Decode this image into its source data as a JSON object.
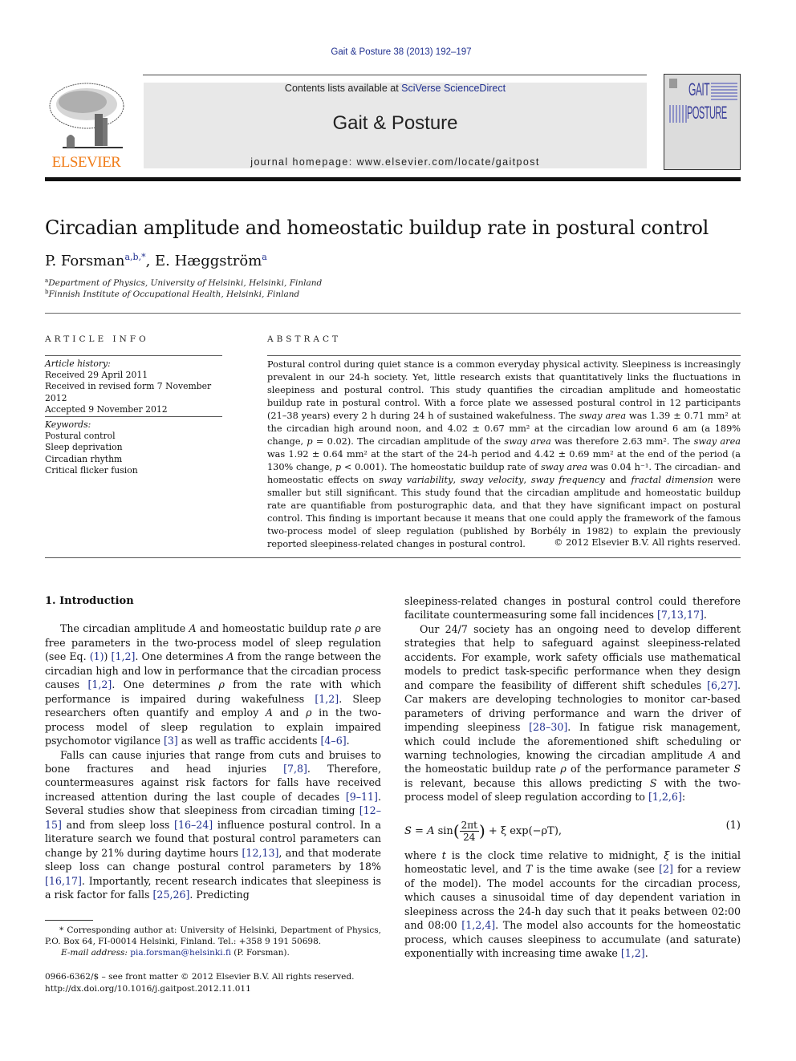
{
  "header": {
    "journal_ref": "Gait & Posture 38 (2013) 192–197",
    "contents_prefix": "Contents lists available at ",
    "contents_link": "SciVerse ScienceDirect",
    "journal_name": "Gait & Posture",
    "homepage_prefix": "journal homepage: ",
    "homepage_url": "www.elsevier.com/locate/gaitpost",
    "publisher_logo_text": "ELSEVIER",
    "cover_title_top": "GAIT",
    "cover_title_bottom": "POSTURE",
    "colors": {
      "link": "#1f2f8f",
      "publisher_orange": "#f07d1a",
      "banner_bg": "#e8e8e8",
      "cover_blue": "#3a3f9a"
    }
  },
  "article": {
    "title": "Circadian amplitude and homeostatic buildup rate in postural control",
    "authors": [
      {
        "name": "P. Forsman",
        "sup": "a,b,*"
      },
      {
        "name": "E. Hæggström",
        "sup": "a"
      }
    ],
    "affiliations": [
      {
        "mark": "a",
        "text": "Department of Physics, University of Helsinki, Helsinki, Finland"
      },
      {
        "mark": "b",
        "text": "Finnish Institute of Occupational Health, Helsinki, Finland"
      }
    ]
  },
  "article_info": {
    "heading": "ARTICLE INFO",
    "history_label": "Article history:",
    "history": [
      "Received 29 April 2011",
      "Received in revised form 7 November 2012",
      "Accepted 9 November 2012"
    ],
    "keywords_label": "Keywords:",
    "keywords": [
      "Postural control",
      "Sleep deprivation",
      "Circadian rhythm",
      "Critical flicker fusion"
    ]
  },
  "abstract": {
    "heading": "ABSTRACT",
    "parts": [
      "Postural control during quiet stance is a common everyday physical activity. Sleepiness is increasingly prevalent in our 24-h society. Yet, little research exists that quantitatively links the fluctuations in sleepiness and postural control. This study quantifies the circadian amplitude and homeostatic buildup rate in postural control. With a force plate we assessed postural control in 12 participants (21–38 years) every 2 h during 24 h of sustained wakefulness. The ",
      "sway area",
      " was 1.39 ± 0.71 mm² at the circadian high around noon, and 4.02 ± 0.67 mm² at the circadian low around 6 am (a 189% change, ",
      "p",
      " = 0.02). The circadian amplitude of the ",
      "sway area",
      " was therefore 2.63 mm². The ",
      "sway area",
      " was 1.92 ± 0.64 mm² at the start of the 24-h period and 4.42 ± 0.69 mm² at the end of the period (a 130% change, ",
      "p",
      " < 0.001). The homeostatic buildup rate of ",
      "sway area",
      " was 0.04 h⁻¹. The circadian- and homeostatic effects on ",
      "sway variability",
      ", ",
      "sway velocity",
      ", ",
      "sway frequency",
      " and ",
      "fractal dimension",
      " were smaller but still significant. This study found that the circadian amplitude and homeostatic buildup rate are quantifiable from posturographic data, and that they have significant impact on postural control. This finding is important because it means that one could apply the framework of the famous two-process model of sleep regulation (published by Borbély in 1982) to explain the previously reported sleepiness-related changes in postural control."
    ],
    "copyright": "© 2012 Elsevier B.V. All rights reserved."
  },
  "body": {
    "section1_heading": "1.  Introduction",
    "p1": [
      "The circadian amplitude ",
      "A",
      " and homeostatic buildup rate ",
      "ρ",
      " are free parameters in the two-process model of sleep regulation (see Eq. ",
      "(1)",
      ") ",
      "[1,2]",
      ". One determines ",
      "A",
      " from the range between the circadian high and low in performance that the circadian process causes ",
      "[1,2]",
      ". One determines ",
      "ρ",
      " from the rate with which performance is impaired during wakefulness ",
      "[1,2]",
      ". Sleep researchers often quantify and employ ",
      "A",
      " and ",
      "ρ",
      " in the two-process model of sleep regulation to explain impaired psychomotor vigilance ",
      "[3]",
      " as well as traffic accidents ",
      "[4–6]",
      "."
    ],
    "p2": [
      "Falls can cause injuries that range from cuts and bruises to bone fractures and head injuries ",
      "[7,8]",
      ". Therefore, countermeasures against risk factors for falls have received increased attention during the last couple of decades ",
      "[9–11]",
      ". Several studies show that sleepiness from circadian timing ",
      "[12–15]",
      " and from sleep loss ",
      "[16–24]",
      " influence postural control. In a literature search we found that postural control parameters can change by 21% during daytime hours ",
      "[12,13]",
      ", and that moderate sleep loss can change postural control parameters by 18% ",
      "[16,17]",
      ". Importantly, recent research indicates that sleepiness is a risk factor for falls ",
      "[25,26]",
      ". Predicting sleepiness-related changes in postural control could therefore facilitate countermeasuring some fall incidences ",
      "[7,13,17]",
      "."
    ],
    "p3": [
      "Our 24/7 society has an ongoing need to develop different strategies that help to safeguard against sleepiness-related accidents. For example, work safety officials use mathematical models to predict task-specific performance when they design and compare the feasibility of different shift schedules ",
      "[6,27]",
      ". Car makers are developing technologies to monitor car-based parameters of driving performance and warn the driver of impending sleepiness ",
      "[28–30]",
      ". In fatigue risk management, which could include the aforementioned shift scheduling or warning technologies, knowing the circadian amplitude ",
      "A",
      " and the homeostatic buildup rate ",
      "ρ",
      " of the performance parameter ",
      "S",
      " is relevant, because this allows predicting ",
      "S",
      " with the two-process model of sleep regulation according to ",
      "[1,2,6]",
      ":"
    ],
    "equation": {
      "lhs": "S",
      "eq": " = ",
      "A": "A",
      "sin": " sin",
      "num": "2πt",
      "den": "24",
      "rest": " + ξ exp(−ρT),",
      "number": "(1)"
    },
    "p4": [
      "where ",
      "t",
      " is the clock time relative to midnight, ",
      "ξ",
      " is the initial homeostatic level, and ",
      "T",
      " is the time awake (see ",
      "[2]",
      " for a review of the model). The model accounts for the circadian process, which causes a sinusoidal time of day dependent variation in sleepiness across the 24-h day such that it peaks between 02:00 and 08:00 ",
      "[1,2,4]",
      ". The model also accounts for the homeostatic process, which causes sleepiness to accumulate (and saturate) exponentially with increasing time awake ",
      "[1,2]",
      "."
    ]
  },
  "footnote": {
    "corresponding": "* Corresponding author at: University of Helsinki, Department of Physics, P.O. Box 64, FI-00014 Helsinki, Finland. Tel.: +358 9 191 50698.",
    "email_label": "E-mail address: ",
    "email": "pia.forsman@helsinki.fi",
    "email_suffix": " (P. Forsman)."
  },
  "footer": {
    "issn": "0966-6362/$ – see front matter © 2012 Elsevier B.V. All rights reserved.",
    "doi": "http://dx.doi.org/10.1016/j.gaitpost.2012.11.011"
  }
}
